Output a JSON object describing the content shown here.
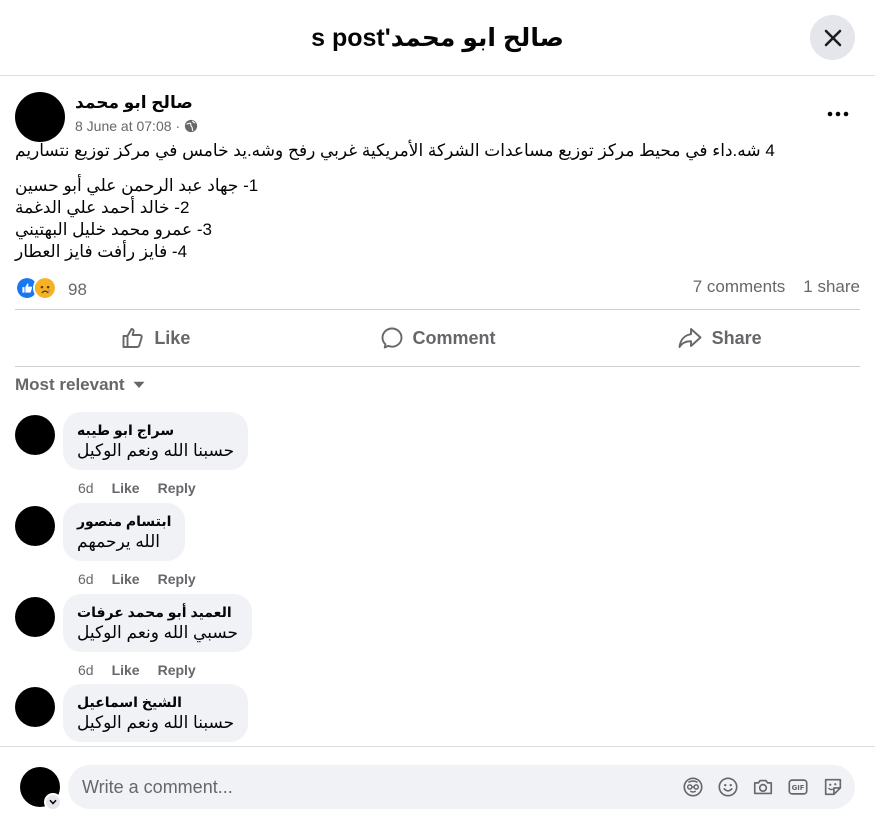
{
  "dialog": {
    "title": "صالح ابو محمد's post"
  },
  "post": {
    "author": "صالح ابو محمد",
    "date": "8 June at 07:08",
    "separator": "·",
    "privacy_icon": "globe-icon",
    "text_lines": [
      "4 شه.داء في محيط مركز توزيع مساعدات الشركة الأمريكية غربي رفح وشه.يد خامس  في مركز توزيع  نتساريم",
      "",
      "1- جهاد عبد الرحمن علي أبو حسين",
      "2- خالد أحمد علي الدغمة",
      "3- عمرو محمد خليل البهتيني",
      "4- فايز رأفت فايز العطار"
    ]
  },
  "stats": {
    "reactions": [
      "like",
      "sad"
    ],
    "reaction_count": "98",
    "comments": "7 comments",
    "shares": "1 share"
  },
  "actions": {
    "like": "Like",
    "comment": "Comment",
    "share": "Share"
  },
  "sort": {
    "label": "Most relevant"
  },
  "comments": [
    {
      "name": "سراج ابو طيبه",
      "text": "حسبنا الله ونعم الوكيل",
      "age": "6d",
      "like": "Like",
      "reply": "Reply"
    },
    {
      "name": "ابتسام منصور",
      "text": "الله يرحمهم",
      "age": "6d",
      "like": "Like",
      "reply": "Reply"
    },
    {
      "name": "العميد أبو محمد عرفات",
      "text": "حسبي الله ونعم الوكيل",
      "age": "6d",
      "like": "Like",
      "reply": "Reply"
    },
    {
      "name": "الشيخ اسماعيل",
      "text": "حسبنا الله ونعم الوكيل",
      "age": "",
      "like": "",
      "reply": ""
    }
  ],
  "composer": {
    "placeholder": "Write a comment...",
    "tools": [
      "avatar-sticker-icon",
      "emoji-icon",
      "camera-icon",
      "gif-icon",
      "sticker-icon"
    ]
  },
  "colors": {
    "like_blue": "#1877f2",
    "sad_yellow": "#f7b125",
    "secondary_text": "#65676b",
    "bubble_bg": "#f0f2f5"
  }
}
